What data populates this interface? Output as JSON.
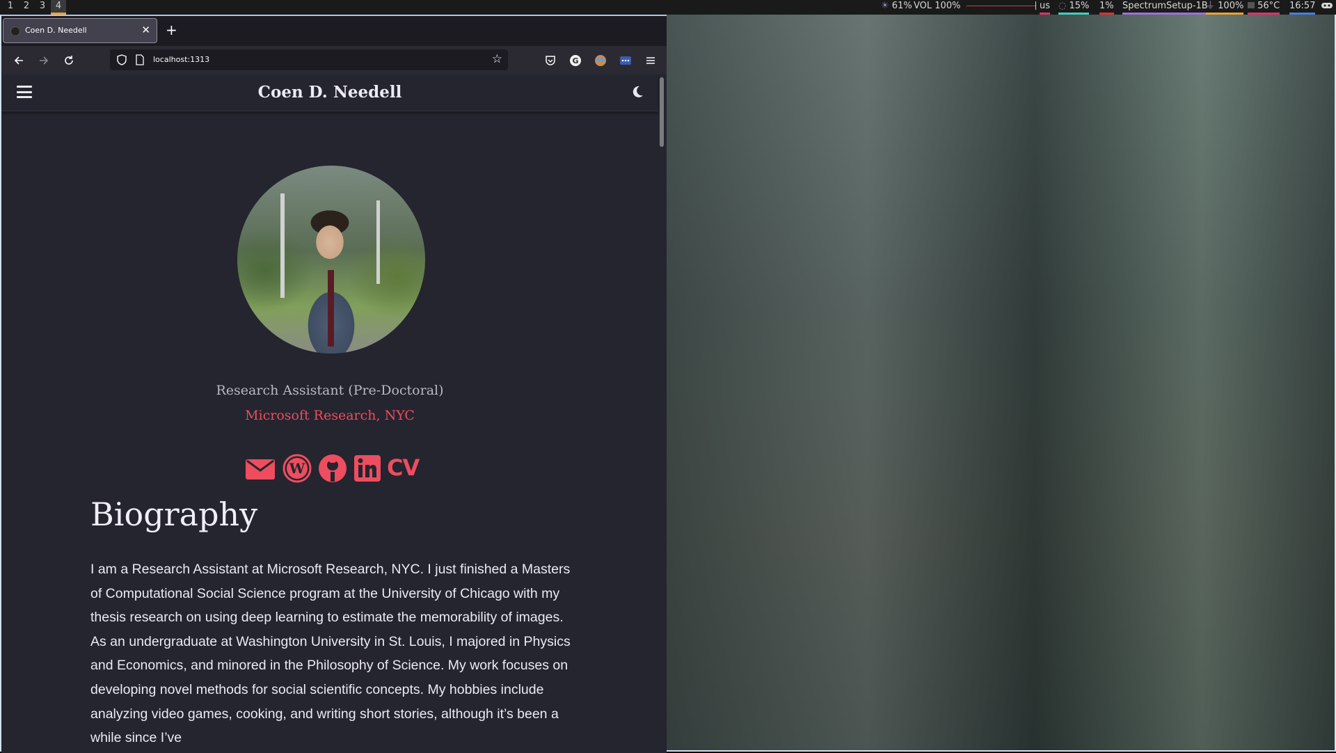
{
  "statusbar": {
    "workspaces": [
      "1",
      "2",
      "3",
      "4"
    ],
    "active_workspace": "4",
    "brightness": "61%",
    "volume": "VOL 100%",
    "keyboard_layout": "us",
    "cpu": "15%",
    "memory": "1%",
    "wifi": "SpectrumSetup-1B",
    "battery": "100%",
    "temperature": "56°C",
    "time": "16:57"
  },
  "browser": {
    "tab_title": "Coen D. Needell",
    "url": "localhost:1313"
  },
  "site": {
    "title": "Coen D. Needell",
    "job_title": "Research Assistant (Pre-Doctoral)",
    "organization": "Microsoft Research, NYC",
    "social_icons": [
      "envelope-icon",
      "wordpress-icon",
      "github-icon",
      "linkedin-icon",
      "cv-icon"
    ],
    "cv_label": "CV",
    "bio_heading": "Biography",
    "bio_text": "I am a Research Assistant at Microsoft Research, NYC. I just finished a Masters of Computational Social Science program at the University of Chicago with my thesis research on using deep learning to estimate the memorability of images. As an undergraduate at Washington University in St. Louis, I majored in Physics and Economics, and minored in the Philosophy of Science. My work focuses on developing novel methods for social scientific concepts. My hobbies include analyzing video games, cooking, and writing short stories, although it’s been a while since I’ve"
  },
  "colors": {
    "accent": "#ee4d5f",
    "page_background": "#24252f",
    "text": "#eceaf4",
    "muted_text": "#b9b8c4",
    "workspace_highlight": "#f0a030"
  }
}
